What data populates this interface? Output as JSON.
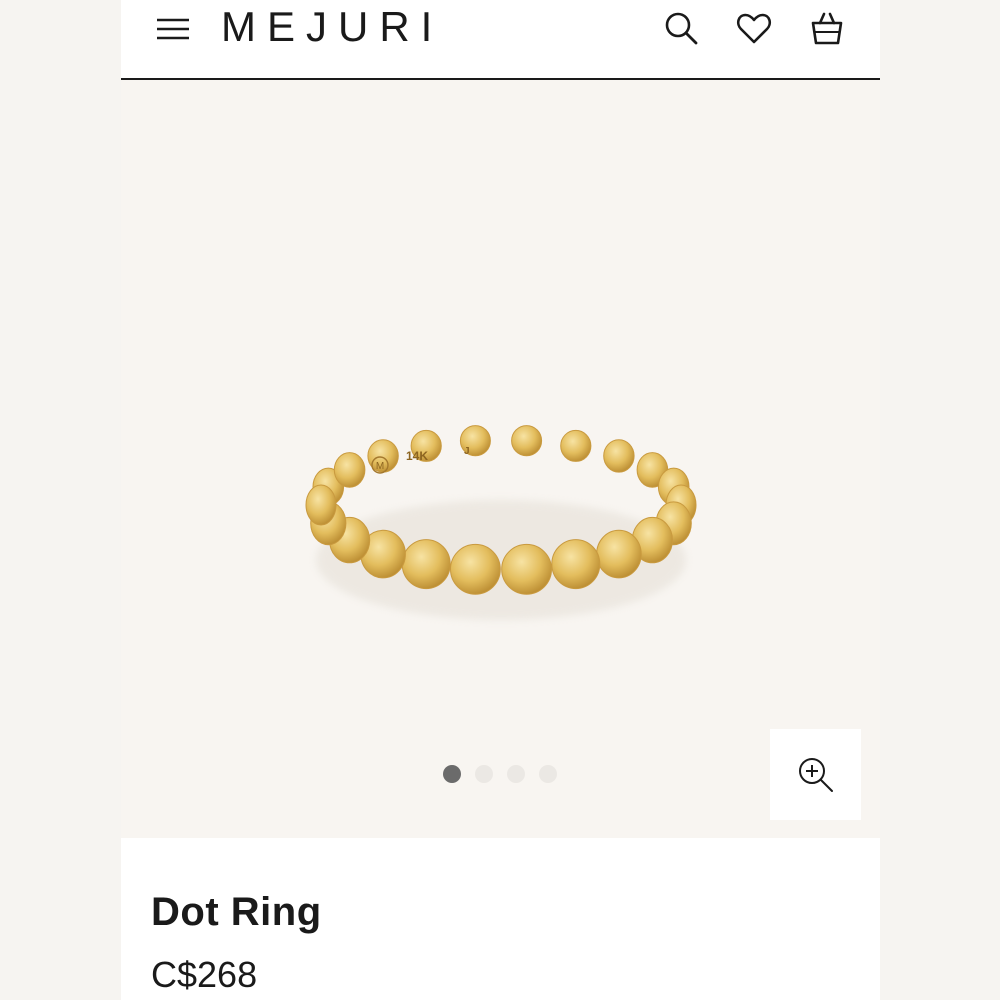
{
  "header": {
    "logo": "MEJURI",
    "icons": [
      "menu-icon",
      "search-icon",
      "heart-icon",
      "bag-icon"
    ]
  },
  "gallery": {
    "image_engraving": {
      "brand_mark": "M",
      "karat": "14K",
      "size": "J"
    },
    "dots_count": 4,
    "active_dot": 1,
    "zoom_icon": "zoom-in-icon"
  },
  "product": {
    "name": "Dot Ring",
    "price": "C$268"
  },
  "colors": {
    "text": "#1a1a1a",
    "gallery_bg": "#f8f5f1",
    "gold": "#e8c56a",
    "active_dot": "#6b6b6b",
    "inactive_dot": "#ebe8e4"
  }
}
